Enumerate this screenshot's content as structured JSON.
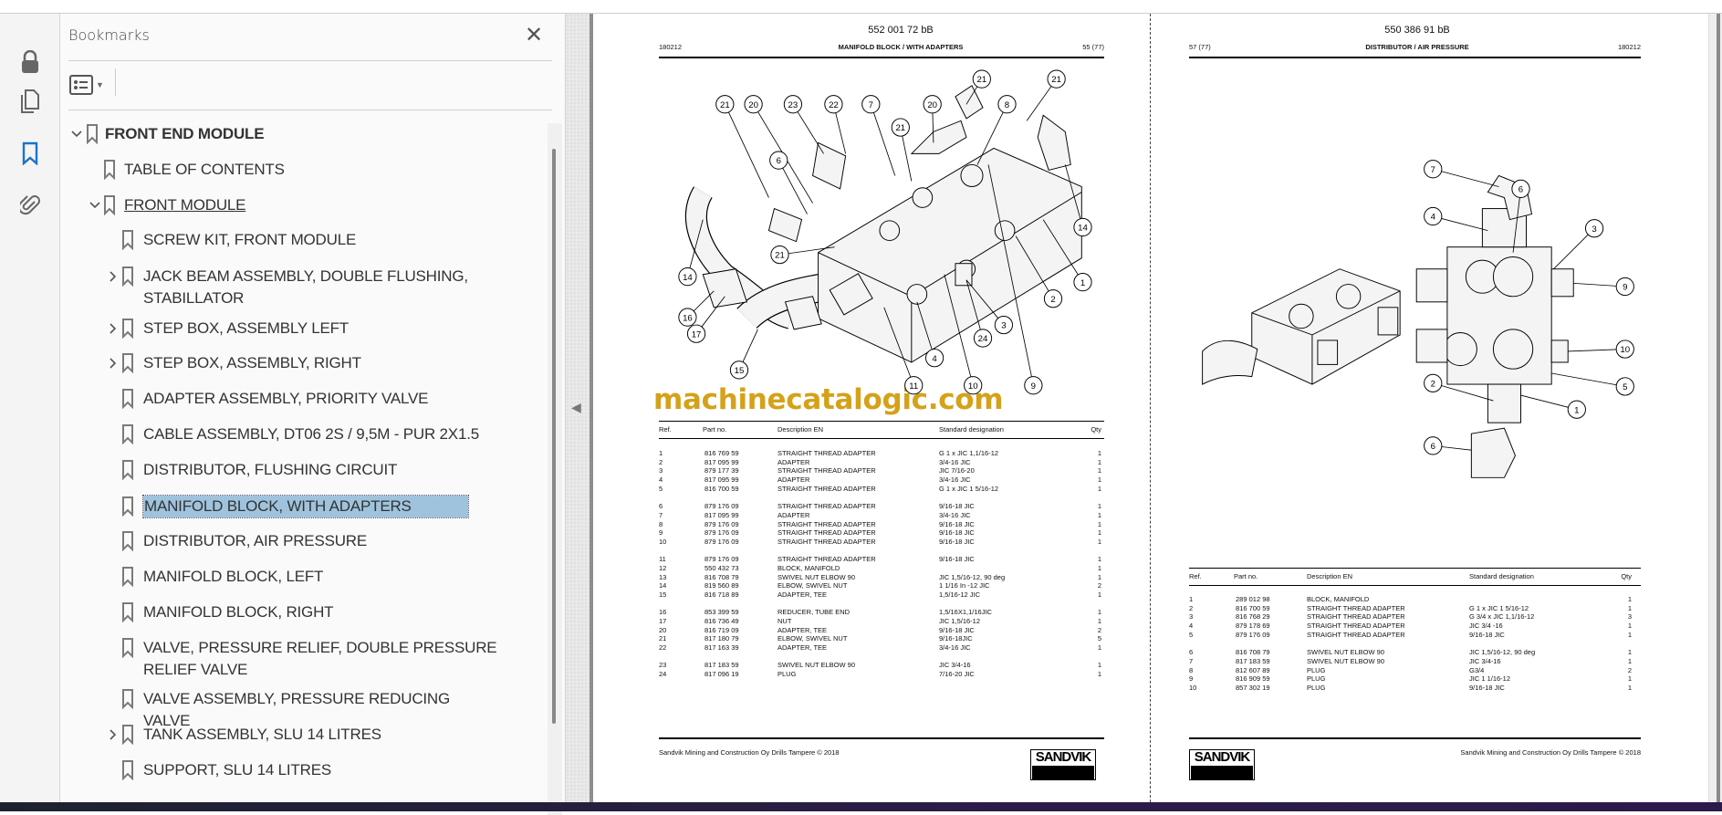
{
  "sidebar_rail": {
    "icons": [
      "lock-icon",
      "pages-icon",
      "bookmark-icon",
      "attachment-icon"
    ],
    "active": "bookmark-icon",
    "accent": "#1a73c9"
  },
  "bookmarks_panel": {
    "title": "Bookmarks",
    "close_label": "✕",
    "items": [
      {
        "label": "FRONT END MODULE",
        "level": 0,
        "toggle": "expanded",
        "bold": true
      },
      {
        "label": "TABLE OF CONTENTS",
        "level": 1,
        "toggle": "none"
      },
      {
        "label": "FRONT MODULE",
        "level": 1,
        "toggle": "expanded",
        "underline": true
      },
      {
        "label": "SCREW KIT, FRONT MODULE",
        "level": 2,
        "toggle": "none"
      },
      {
        "label": "JACK BEAM ASSEMBLY, DOUBLE FLUSHING, STABILLATOR",
        "level": 2,
        "toggle": "collapsed",
        "lines": 2
      },
      {
        "label": "STEP BOX, ASSEMBLY LEFT",
        "level": 2,
        "toggle": "collapsed"
      },
      {
        "label": "STEP BOX, ASSEMBLY, RIGHT",
        "level": 2,
        "toggle": "collapsed"
      },
      {
        "label": "ADAPTER ASSEMBLY, PRIORITY VALVE",
        "level": 2,
        "toggle": "none"
      },
      {
        "label": "CABLE ASSEMBLY, DT06 2S / 9,5M - PUR 2X1.5",
        "level": 2,
        "toggle": "none"
      },
      {
        "label": "DISTRIBUTOR, FLUSHING CIRCUIT",
        "level": 2,
        "toggle": "none"
      },
      {
        "label": "MANIFOLD BLOCK, WITH ADAPTERS",
        "level": 2,
        "toggle": "none",
        "selected": true
      },
      {
        "label": "DISTRIBUTOR, AIR PRESSURE",
        "level": 2,
        "toggle": "none"
      },
      {
        "label": "MANIFOLD BLOCK, LEFT",
        "level": 2,
        "toggle": "none"
      },
      {
        "label": "MANIFOLD BLOCK, RIGHT",
        "level": 2,
        "toggle": "none"
      },
      {
        "label": "VALVE, PRESSURE RELIEF, DOUBLE PRESSURE RELIEF VALVE",
        "level": 2,
        "toggle": "none",
        "lines": 2
      },
      {
        "label": "VALVE ASSEMBLY, PRESSURE REDUCING VALVE",
        "level": 2,
        "toggle": "none"
      },
      {
        "label": "TANK ASSEMBLY, SLU 14 LITRES",
        "level": 2,
        "toggle": "collapsed"
      },
      {
        "label": "SUPPORT, SLU 14 LITRES",
        "level": 2,
        "toggle": "none"
      }
    ]
  },
  "pages": [
    {
      "doc_number": "552 001 72 bB",
      "date": "180212",
      "title": "MANIFOLD BLOCK / WITH ADAPTERS",
      "page": "55 (77)",
      "callouts": [
        "21",
        "20",
        "23",
        "22",
        "7",
        "20",
        "21",
        "21",
        "8",
        "21",
        "6",
        "14",
        "1",
        "2",
        "3",
        "24",
        "4",
        "11",
        "10",
        "9",
        "15",
        "16",
        "17",
        "14",
        "21"
      ],
      "table_headers": [
        "Ref.",
        "Part no.",
        "Description EN",
        "Standard designation",
        "Qty"
      ],
      "groups": [
        [
          [
            "1",
            "816 769 59",
            "STRAIGHT THREAD ADAPTER",
            "G 1 x JIC 1,1/16-12",
            "1"
          ],
          [
            "2",
            "817 095 99",
            "ADAPTER",
            "3/4-16 JIC",
            "1"
          ],
          [
            "3",
            "879 177 39",
            "STRAIGHT THREAD ADAPTER",
            "JIC 7/16-20",
            "1"
          ],
          [
            "4",
            "817 095 99",
            "ADAPTER",
            "3/4-16 JIC",
            "1"
          ],
          [
            "5",
            "816 700 59",
            "STRAIGHT THREAD ADAPTER",
            "G 1 x JIC 1 5/16-12",
            "1"
          ]
        ],
        [
          [
            "6",
            "879 176 09",
            "STRAIGHT THREAD ADAPTER",
            "9/16-18 JIC",
            "1"
          ],
          [
            "7",
            "817 095 99",
            "ADAPTER",
            "3/4-16 JIC",
            "1"
          ],
          [
            "8",
            "879 176 09",
            "STRAIGHT THREAD ADAPTER",
            "9/16-18 JIC",
            "1"
          ],
          [
            "9",
            "879 176 09",
            "STRAIGHT THREAD ADAPTER",
            "9/16-18 JIC",
            "1"
          ],
          [
            "10",
            "879 176 09",
            "STRAIGHT THREAD ADAPTER",
            "9/16-18 JIC",
            "1"
          ]
        ],
        [
          [
            "11",
            "879 176 09",
            "STRAIGHT THREAD ADAPTER",
            "9/16-18 JIC",
            "1"
          ],
          [
            "12",
            "550 432 73",
            "BLOCK, MANIFOLD",
            "",
            "1"
          ],
          [
            "13",
            "816 708 79",
            "SWIVEL NUT ELBOW 90",
            "JIC 1,5/16-12, 90 deg",
            "1"
          ],
          [
            "14",
            "819 560 89",
            "ELBOW, SWIVEL NUT",
            "1 1/16 In -12 JIC",
            "2"
          ],
          [
            "15",
            "816 718 89",
            "ADAPTER, TEE",
            "1,5/16-12 JIC",
            "1"
          ]
        ],
        [
          [
            "16",
            "853 399 59",
            "REDUCER, TUBE END",
            "1,5/16X1,1/16JIC",
            "1"
          ],
          [
            "17",
            "816 736 49",
            "NUT",
            "JIC 1,5/16-12",
            "1"
          ],
          [
            "20",
            "816 719 09",
            "ADAPTER, TEE",
            "9/16-18 JIC",
            "2"
          ],
          [
            "21",
            "817 180 79",
            "ELBOW, SWIVEL NUT",
            "9/16-18JIC",
            "5"
          ],
          [
            "22",
            "817 163 39",
            "ADAPTER, TEE",
            "3/4-16 JIC",
            "1"
          ]
        ],
        [
          [
            "23",
            "817 183 59",
            "SWIVEL NUT ELBOW 90",
            "JIC 3/4-16",
            "1"
          ],
          [
            "24",
            "817 096 19",
            "PLUG",
            "7/16-20 JIC",
            "1"
          ]
        ]
      ],
      "footer": "Sandvik Mining and Construction Oy Drills Tampere © 2018",
      "logo": "SANDVIK"
    },
    {
      "doc_number": "550 386 91 bB",
      "date": "180212",
      "title": "DISTRIBUTOR / AIR PRESSURE",
      "page": "57 (77)",
      "callouts": [
        "7",
        "6",
        "4",
        "3",
        "9",
        "10",
        "5",
        "1",
        "2",
        "6"
      ],
      "table_headers": [
        "Ref.",
        "Part no.",
        "Description EN",
        "Standard designation",
        "Qty"
      ],
      "groups": [
        [
          [
            "1",
            "289 012 98",
            "BLOCK, MANIFOLD",
            "",
            "1"
          ],
          [
            "2",
            "816 700 59",
            "STRAIGHT THREAD ADAPTER",
            "G 1 x JIC 1 5/16-12",
            "1"
          ],
          [
            "3",
            "816 768 29",
            "STRAIGHT THREAD ADAPTER",
            "G 3/4 x JIC 1,1/16-12",
            "3"
          ],
          [
            "4",
            "879 178 69",
            "STRAIGHT THREAD ADAPTER",
            "JIC 3/4 -16",
            "1"
          ],
          [
            "5",
            "879 176 09",
            "STRAIGHT THREAD ADAPTER",
            "9/16-18 JIC",
            "1"
          ]
        ],
        [
          [
            "6",
            "816 708 79",
            "SWIVEL NUT ELBOW 90",
            "JIC 1,5/16-12, 90 deg",
            "1"
          ],
          [
            "7",
            "817 183 59",
            "SWIVEL NUT ELBOW 90",
            "JIC 3/4-16",
            "1"
          ],
          [
            "8",
            "812 607 89",
            "PLUG",
            "G3/4",
            "2"
          ],
          [
            "9",
            "816 909 59",
            "PLUG",
            "JIC 1 1/16-12",
            "1"
          ],
          [
            "10",
            "857 302 19",
            "PLUG",
            "9/16-18 JIC",
            "1"
          ]
        ]
      ],
      "footer": "Sandvik Mining and Construction Oy Drills Tampere © 2018",
      "logo": "SANDVIK"
    }
  ],
  "watermark": "machinecatalogic.com",
  "colors": {
    "selection": "#9fc3dd",
    "watermark": "#d4a21a",
    "accent": "#1a73c9"
  }
}
